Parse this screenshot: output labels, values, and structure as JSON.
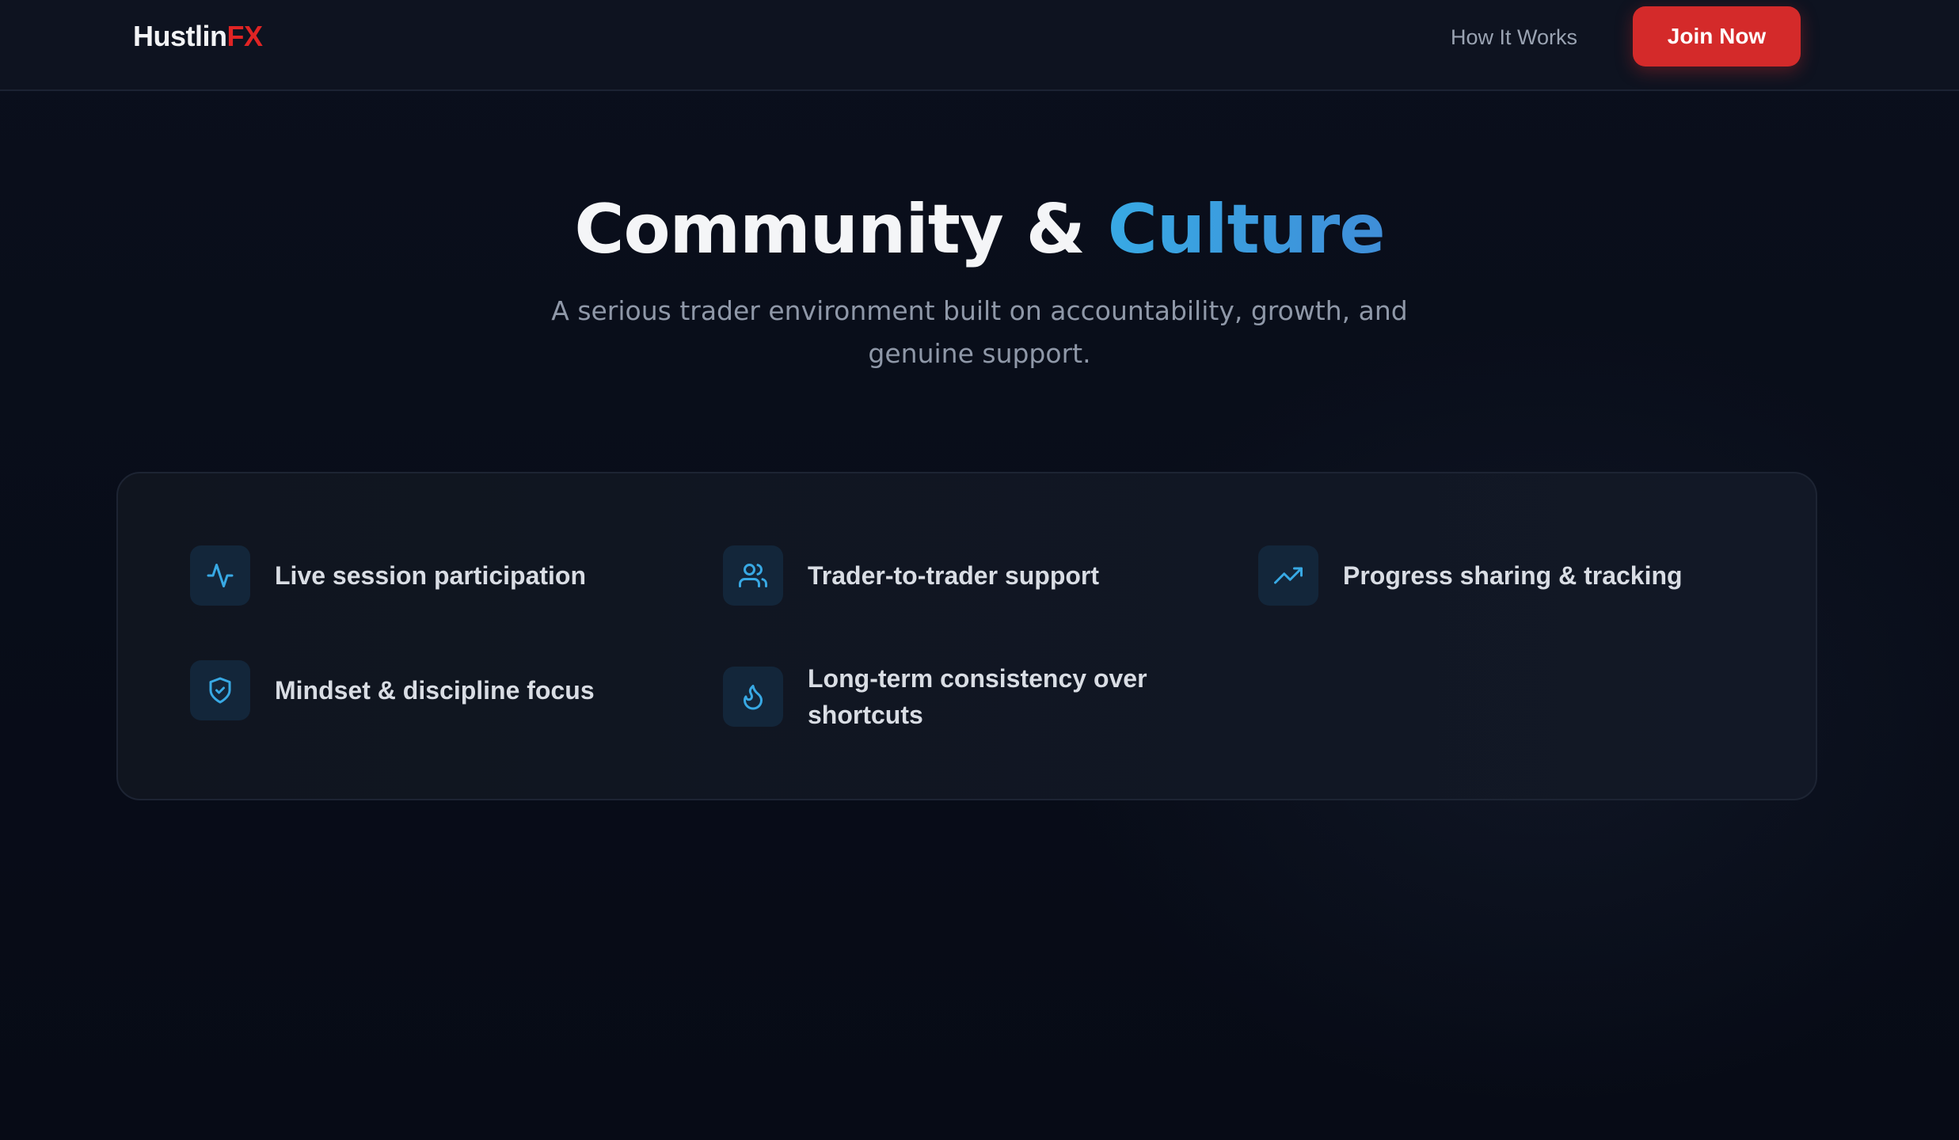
{
  "header": {
    "logo_main": "Hustlin",
    "logo_accent": "FX",
    "nav_link": "How It Works",
    "cta_label": "Join Now"
  },
  "hero": {
    "title_main": "Community & ",
    "title_accent": "Culture",
    "subtitle": "A serious trader environment built on accountability, growth, and genuine support."
  },
  "features": [
    {
      "label": "Live session participation",
      "icon": "activity-icon"
    },
    {
      "label": "Trader-to-trader support",
      "icon": "users-icon"
    },
    {
      "label": "Progress sharing & tracking",
      "icon": "trending-up-icon"
    },
    {
      "label": "Mindset & discipline focus",
      "icon": "shield-check-icon"
    },
    {
      "label": "Long-term consistency over shortcuts",
      "icon": "flame-icon"
    }
  ],
  "colors": {
    "background": "#080c17",
    "brand_red": "#d42a2a",
    "accent_blue": "#3a9fe0",
    "icon_tile": "#13263a"
  }
}
